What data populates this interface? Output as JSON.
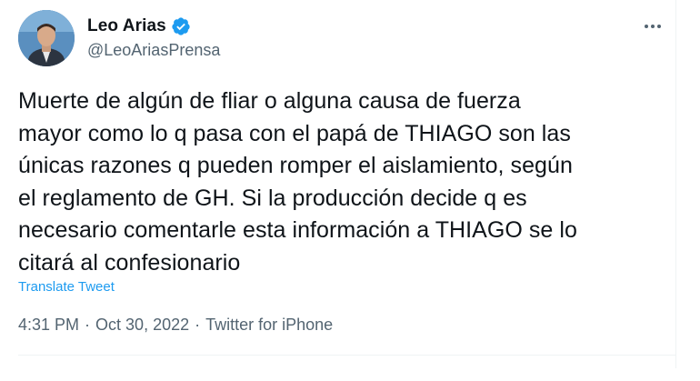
{
  "author": {
    "display_name": "Leo Arias",
    "handle": "@LeoAriasPrensa",
    "verified": true,
    "avatar_icon": "profile-photo",
    "verified_icon": "verified-badge-icon"
  },
  "tweet": {
    "text_lines": [
      "Muerte de algún de fliar o alguna causa de fuerza",
      "mayor como lo q pasa con el papá de THIAGO son las",
      "únicas razones q pueden romper el aislamiento, según",
      "el reglamento de GH. Si la producción decide q es",
      "necesario comentarle esta información a THIAGO se lo",
      "citará al confesionario"
    ],
    "translate_label": "Translate Tweet",
    "time": "4:31 PM",
    "separator": "·",
    "date": "Oct 30, 2022",
    "source": "Twitter for iPhone"
  },
  "menu": {
    "more_icon": "more-horizontal-icon"
  },
  "colors": {
    "text": "#0f1419",
    "secondary": "#536471",
    "accent": "#1d9bf0",
    "divider": "#eff3f4"
  }
}
